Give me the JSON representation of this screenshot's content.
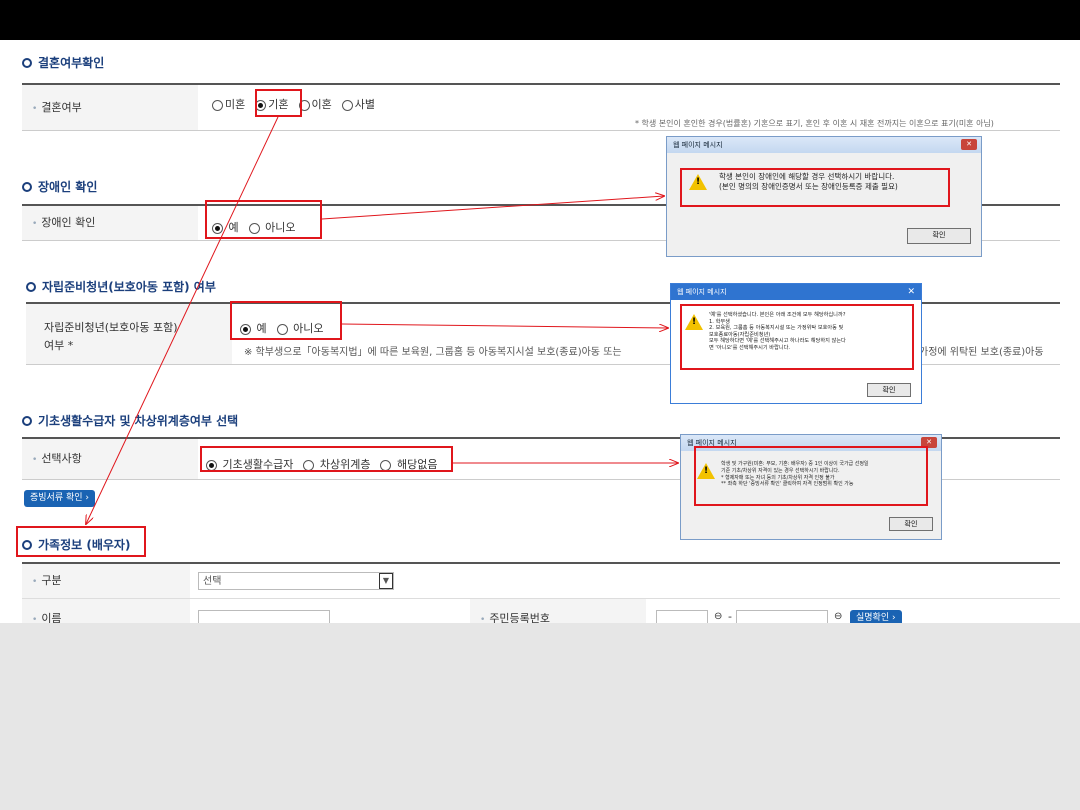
{
  "marriage": {
    "title": "결혼여부확인",
    "label": "결혼여부",
    "options": [
      "미혼",
      "기혼",
      "이혼",
      "사별"
    ],
    "selected": "기혼",
    "note": "* 학생 본인이 혼인한 경우(법률혼) 기혼으로 표기, 혼인 후 이혼 시 재혼 전까지는 이혼으로 표기(미혼 아님)"
  },
  "disability": {
    "title": "장애인 확인",
    "label": "장애인 확인",
    "options": [
      "예",
      "아니오"
    ],
    "selected": "예"
  },
  "independent": {
    "title": "자립준비청년(보호아동 포함) 여부",
    "label_line1": "자립준비청년(보호아동 포함)",
    "label_line2": "여부 *",
    "options": [
      "예",
      "아니오"
    ],
    "selected": "예",
    "note_left": "※ 학부생으로「아동복지법」에 따른 보육원, 그룹홈 등 아동복지시설 보호(종료)아동 또는",
    "note_right": "가정에 위탁된 보호(종료)아동"
  },
  "welfare": {
    "title": "기초생활수급자 및 차상위계층여부 선택",
    "label": "선택사항",
    "options": [
      "기초생활수급자",
      "차상위계층",
      "해당없음"
    ],
    "selected": "기초생활수급자",
    "doc_button": "증빙서류 확인"
  },
  "family": {
    "title": "가족정보 (배우자)",
    "type_label": "구분",
    "type_value": "선택",
    "name_label": "이름",
    "rrn_label": "주민등록번호",
    "rrn_sep": "-",
    "verify_button": "실명확인"
  },
  "dialogs": {
    "d1": {
      "title": "웹 페이지 메시지",
      "message": "학생 본인이 장애인에 해당할 경우 선택하시기 바랍니다.\n(본인 명의의 장애인증명서 또는 장애인등록증 제출 필요)",
      "ok": "확인"
    },
    "d2": {
      "title": "웹 페이지 메시지",
      "message": "'예'를 선택하셨습니다. 본인은 아래 조건에 모두 해당하십니까?\n1. 학부생\n2. 보육원, 그룹홈 등 아동복지시설 또는 가정위탁 보호아동 및\n보호종료아동(자립준비청년)\n모두 해당하다면 '예'를 선택해주시고 하나라도 해당하지 않는다\n면 '아니오'를 선택해주시기 바랍니다.",
      "ok": "확인"
    },
    "d3": {
      "title": "웹 페이지 메시지",
      "message": "학생 및 가구원(미혼: 부모, 기혼: 배우자) 중 1인 이상이 국가급 선정일\n기준 기초/차상위 자격이 있는 경우 선택하시기 바랍니다.\n* 형제자매 또는 자녀 등의 기초/차상위 자격 인정 불가\n** 좌측 하단 '증빙서류 확인' 클릭하여 자격 인정범위 확인 가능",
      "ok": "확인"
    }
  },
  "colors": {
    "accent": "#1b3f7c",
    "highlight": "#e0161c",
    "button": "#1a63b3"
  }
}
